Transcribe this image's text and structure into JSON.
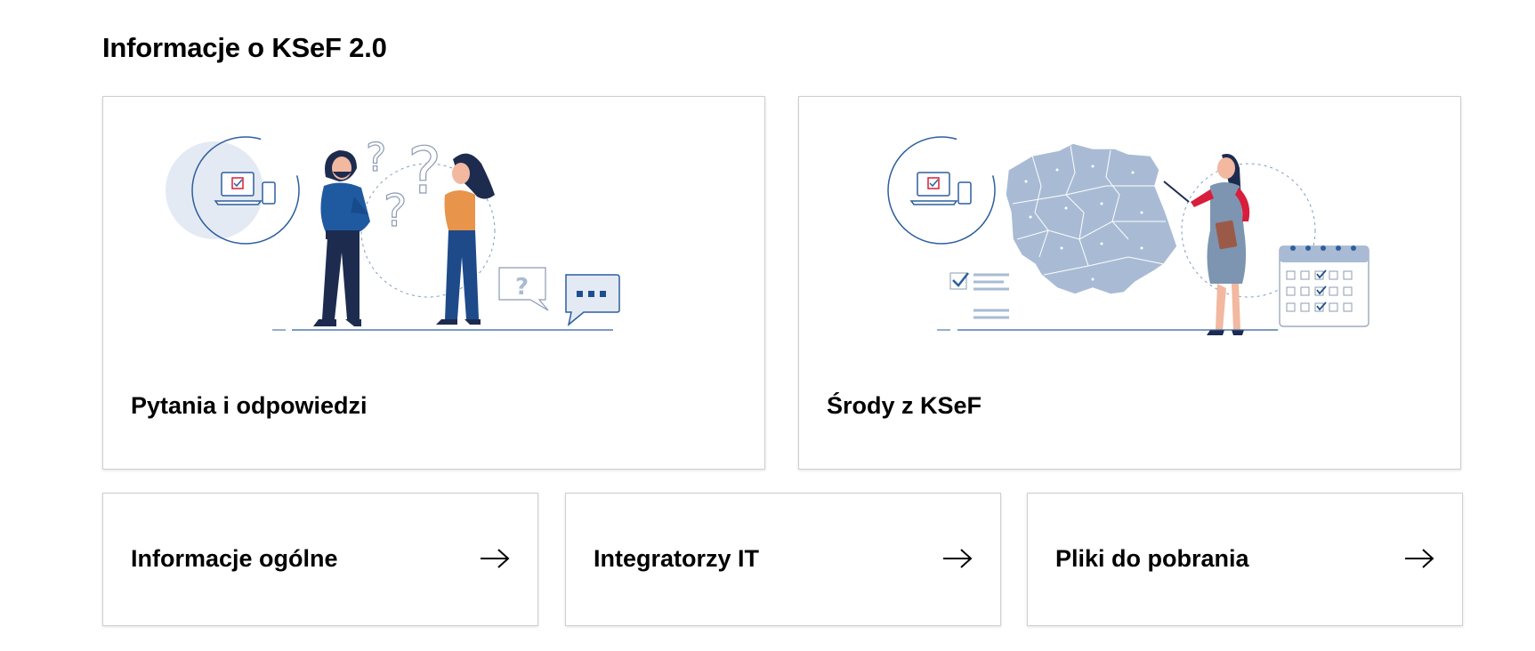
{
  "section": {
    "title": "Informacje o KSeF 2.0"
  },
  "featured": [
    {
      "label": "Pytania i odpowiedzi",
      "illustration": "people-questions-illustration"
    },
    {
      "label": "Środy z KSeF",
      "illustration": "poland-map-presenter-illustration"
    }
  ],
  "links": [
    {
      "label": "Informacje ogólne",
      "icon": "arrow-right-icon"
    },
    {
      "label": "Integratorzy IT",
      "icon": "arrow-right-icon"
    },
    {
      "label": "Pliki do pobrania",
      "icon": "arrow-right-icon"
    }
  ],
  "colors": {
    "navy": "#1d2b4f",
    "blue": "#2d5f9e",
    "lightblue": "#a9bbd4",
    "orange": "#e8944a",
    "red": "#d81e3a"
  }
}
